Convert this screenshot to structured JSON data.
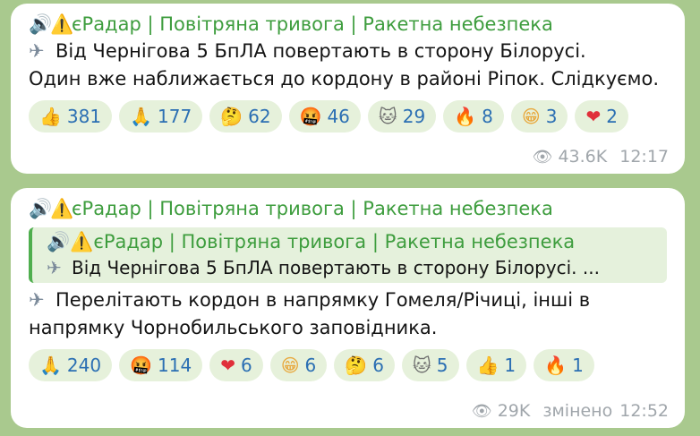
{
  "messages": [
    {
      "title_icons": [
        "🔊",
        "⚠️"
      ],
      "title": "єРадар | Повітряна тривога | Ракетна небезпека",
      "body_icon": "✈",
      "body_line1": "Від Чернігова 5 БпЛА повертають в сторону Білорусі.",
      "body_line2": "Один вже наближається до кордону в районі Ріпок. Слідкуємо.",
      "reactions": [
        {
          "emoji": "👍",
          "count": "381"
        },
        {
          "emoji": "🙏",
          "count": "177"
        },
        {
          "emoji": "🤔",
          "count": "62"
        },
        {
          "emoji": "🤬",
          "count": "46"
        },
        {
          "emoji": "🐱",
          "count": "29"
        },
        {
          "emoji": "🔥",
          "count": "8"
        },
        {
          "emoji": "😁",
          "count": "3"
        },
        {
          "emoji": "❤",
          "count": "2"
        }
      ],
      "views": "43.6K",
      "time": "12:17"
    },
    {
      "title_icons": [
        "🔊",
        "⚠️"
      ],
      "title": "єРадар | Повітряна тривога | Ракетна небезпека",
      "quote": {
        "title": "єРадар | Повітряна тривога | Ракетна небезпека",
        "text": "Від Чернігова 5 БпЛА повертають в сторону Білорусі.  ..."
      },
      "body_icon": "✈",
      "body_line1": "Перелітають кордон в напрямку Гомеля/Річиці, інші в",
      "body_line2": "напрямку Чорнобильського заповідника.",
      "reactions": [
        {
          "emoji": "🙏",
          "count": "240"
        },
        {
          "emoji": "🤬",
          "count": "114"
        },
        {
          "emoji": "❤",
          "count": "6"
        },
        {
          "emoji": "😁",
          "count": "6"
        },
        {
          "emoji": "🤔",
          "count": "6"
        },
        {
          "emoji": "🐱",
          "count": "5"
        },
        {
          "emoji": "👍",
          "count": "1"
        },
        {
          "emoji": "🔥",
          "count": "1"
        }
      ],
      "views": "29K",
      "edited": "змінено",
      "time": "12:52"
    }
  ]
}
